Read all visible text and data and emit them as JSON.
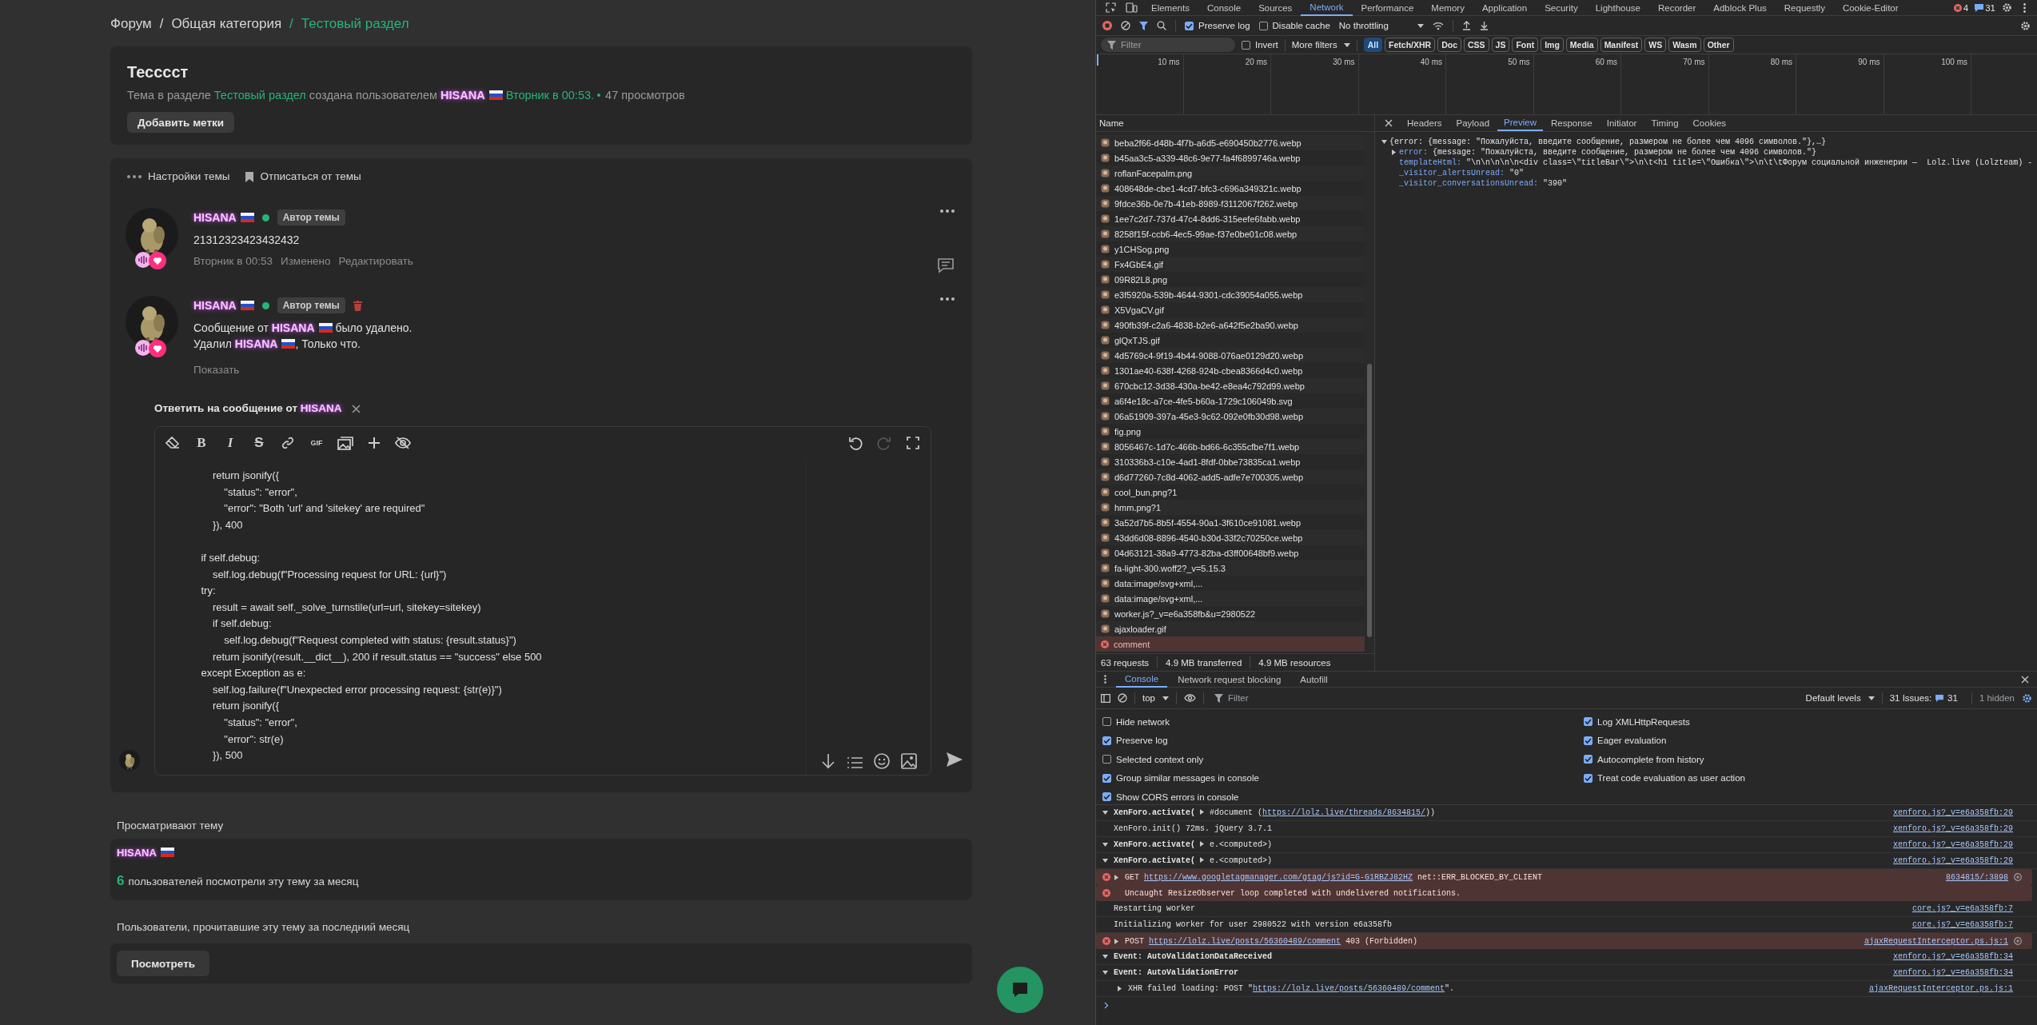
{
  "breadcrumb": {
    "separator": "/",
    "items": [
      {
        "label": "Форум",
        "current": false
      },
      {
        "label": "Общая категория",
        "current": false
      },
      {
        "label": "Тестовый раздел",
        "current": true
      }
    ]
  },
  "thread": {
    "title": "Тесссст",
    "meta": [
      {
        "kind": "text",
        "text": "Тема в разделе"
      },
      {
        "kind": "link",
        "text": "Тестовый раздел"
      },
      {
        "kind": "text",
        "text": "создана пользователем"
      },
      {
        "kind": "user",
        "text": "HISANA"
      },
      {
        "kind": "link",
        "text": "Вторник в 00:53."
      },
      {
        "kind": "stat",
        "text": "47 просмотров"
      }
    ],
    "tag_button": "Добавить метки"
  },
  "thread_actions": [
    "Настройки темы",
    "Отписаться от темы"
  ],
  "posts": [
    {
      "author": "HISANA",
      "online": true,
      "badge": "Автор темы",
      "deleted": false,
      "body": [
        [
          {
            "kind": "text",
            "text": "21312323423432432"
          }
        ]
      ],
      "footer": [
        "Вторник в 00:53",
        "Изменено",
        "Редактировать"
      ]
    },
    {
      "author": "HISANA",
      "online": true,
      "badge": "Автор темы",
      "deleted": true,
      "body": [
        [
          {
            "kind": "text",
            "text": "Сообщение от"
          },
          {
            "kind": "user",
            "text": "HISANA"
          },
          {
            "kind": "text",
            "text": "было удалено."
          }
        ],
        [
          {
            "kind": "text",
            "text": "Удалил"
          },
          {
            "kind": "user",
            "text": "HISANA"
          },
          {
            "kind": "text",
            "text": ", Только что.",
            "attach": true
          }
        ]
      ],
      "footer": [
        "Показать"
      ]
    }
  ],
  "reply": {
    "label": "Ответить на сообщение от",
    "user": "HISANA"
  },
  "editor": {
    "glyphs": {
      "bold": "B",
      "italic": "I",
      "strike": "S",
      "gif": "GIF"
    },
    "redo_disabled": true,
    "lines": [
      {
        "text": "        return jsonify({"
      },
      {
        "text": "            \"status\": \"error\","
      },
      {
        "text": "            \"error\": \"Both 'url' and 'sitekey' are required\""
      },
      {
        "text": "        }), 400"
      },
      {
        "text": "    if self.debug:",
        "space_before": true
      },
      {
        "text": "        self.log.debug(f\"Processing request for URL: {url}\")"
      },
      {
        "text": "    try:"
      },
      {
        "text": "        result = await self._solve_turnstile(url=url, sitekey=sitekey)"
      },
      {
        "text": "        if self.debug:"
      },
      {
        "text": "            self.log.debug(f\"Request completed with status: {result.status}\")"
      },
      {
        "text": "        return jsonify(result.__dict__), 200 if result.status == \"success\" else 500"
      },
      {
        "text": "    except Exception as e:"
      },
      {
        "text": "        self.log.failure(f\"Unexpected error processing request: {str(e)}\")"
      },
      {
        "text": "        return jsonify({"
      },
      {
        "text": "            \"status\": \"error\","
      },
      {
        "text": "            \"error\": str(e)"
      },
      {
        "text": "        }), 500"
      }
    ]
  },
  "viewers": {
    "label": "Просматривают тему",
    "users": [
      "HISANA"
    ],
    "count": "6",
    "count_text": "пользователей посмотрели эту тему за месяц"
  },
  "readers": {
    "label": "Пользователи, прочитавшие эту тему за последний месяц",
    "button": "Посмотреть"
  },
  "devtools": {
    "tabs": [
      {
        "label": "Elements",
        "selected": false
      },
      {
        "label": "Console",
        "selected": false
      },
      {
        "label": "Sources",
        "selected": false
      },
      {
        "label": "Network",
        "selected": true
      },
      {
        "label": "Performance",
        "selected": false
      },
      {
        "label": "Memory",
        "selected": false
      },
      {
        "label": "Application",
        "selected": false
      },
      {
        "label": "Security",
        "selected": false
      },
      {
        "label": "Lighthouse",
        "selected": false
      },
      {
        "label": "Recorder",
        "selected": false
      },
      {
        "label": "Adblock Plus",
        "selected": false
      },
      {
        "label": "Requestly",
        "selected": false
      },
      {
        "label": "Cookie-Editor",
        "selected": false
      }
    ],
    "error_count": "4",
    "issue_count": "31",
    "checkboxes": [
      {
        "label": "Preserve log",
        "checked": true
      },
      {
        "label": "Disable cache",
        "checked": false
      }
    ],
    "throttling": "No throttling",
    "filter": {
      "placeholder": "Filter",
      "invert": {
        "label": "Invert",
        "checked": false
      },
      "more": "More filters",
      "types": [
        {
          "label": "All",
          "selected": true
        },
        {
          "label": "Fetch/XHR",
          "selected": false
        },
        {
          "label": "Doc",
          "selected": false
        },
        {
          "label": "CSS",
          "selected": false
        },
        {
          "label": "JS",
          "selected": false
        },
        {
          "label": "Font",
          "selected": false
        },
        {
          "label": "Img",
          "selected": false
        },
        {
          "label": "Media",
          "selected": false
        },
        {
          "label": "Manifest",
          "selected": false
        },
        {
          "label": "WS",
          "selected": false
        },
        {
          "label": "Wasm",
          "selected": false
        },
        {
          "label": "Other",
          "selected": false
        }
      ]
    },
    "timeline_ticks": [
      "10 ms",
      "20 ms",
      "30 ms",
      "40 ms",
      "50 ms",
      "60 ms",
      "70 ms",
      "80 ms",
      "90 ms",
      "100 ms"
    ],
    "requests": {
      "header": "Name",
      "rows": [
        {
          "name": "beba2f66-d48b-4f7b-a6d5-e690450b2776.webp",
          "failed": false
        },
        {
          "name": "b45aa3c5-a339-48c6-9e77-fa4f6899746a.webp",
          "failed": false
        },
        {
          "name": "roflanFacepalm.png",
          "failed": false
        },
        {
          "name": "408648de-cbe1-4cd7-bfc3-c696a349321c.webp",
          "failed": false
        },
        {
          "name": "9fdce36b-0e7b-41eb-8989-f3112067f262.webp",
          "failed": false
        },
        {
          "name": "1ee7c2d7-737d-47c4-8dd6-315eefe6fabb.webp",
          "failed": false
        },
        {
          "name": "8258f15f-ccb6-4ec5-99ae-f37e0be01c08.webp",
          "failed": false
        },
        {
          "name": "y1CHSog.png",
          "failed": false
        },
        {
          "name": "Fx4GbE4.gif",
          "failed": false
        },
        {
          "name": "09R82L8.png",
          "failed": false
        },
        {
          "name": "e3f5920a-539b-4644-9301-cdc39054a055.webp",
          "failed": false
        },
        {
          "name": "X5VgaCV.gif",
          "failed": false
        },
        {
          "name": "490fb39f-c2a6-4838-b2e6-a642f5e2ba90.webp",
          "failed": false
        },
        {
          "name": "glQxTJS.gif",
          "failed": false
        },
        {
          "name": "4d5769c4-9f19-4b44-9088-076ae0129d20.webp",
          "failed": false
        },
        {
          "name": "1301ae40-638f-4268-924b-cbea8366d4c0.webp",
          "failed": false
        },
        {
          "name": "670cbc12-3d38-430a-be42-e8ea4c792d99.webp",
          "failed": false
        },
        {
          "name": "a6f4e18c-a7ce-4fe5-b60a-1729c106049b.svg",
          "failed": false
        },
        {
          "name": "06a51909-397a-45e3-9c62-092e0fb30d98.webp",
          "failed": false
        },
        {
          "name": "fig.png",
          "failed": false
        },
        {
          "name": "8056467c-1d7c-466b-bd66-6c355cfbe7f1.webp",
          "failed": false
        },
        {
          "name": "310336b3-c10e-4ad1-8fdf-0bbe73835ca1.webp",
          "failed": false
        },
        {
          "name": "d6d77260-7c8d-4062-add5-adfe7e700305.webp",
          "failed": false
        },
        {
          "name": "cool_bun.png?1",
          "failed": false
        },
        {
          "name": "hmm.png?1",
          "failed": false
        },
        {
          "name": "3a52d7b5-8b5f-4554-90a1-3f610ce91081.webp",
          "failed": false
        },
        {
          "name": "43dd6d08-8896-4540-b30d-33f2c70250ce.webp",
          "failed": false
        },
        {
          "name": "04d63121-38a9-4773-82ba-d3ff00648bf9.webp",
          "failed": false
        },
        {
          "name": "fa-light-300.woff2?_v=5.15.3",
          "failed": false
        },
        {
          "name": "data:image/svg+xml,...",
          "failed": false
        },
        {
          "name": "data:image/svg+xml,...",
          "failed": false
        },
        {
          "name": "worker.js?_v=e6a358fb&u=2980522",
          "failed": false
        },
        {
          "name": "ajaxloader.gif",
          "failed": false
        },
        {
          "name": "comment",
          "failed": true
        }
      ],
      "summary": [
        "63 requests",
        "4.9 MB transferred",
        "4.9 MB resources"
      ]
    },
    "detail": {
      "tabs": [
        {
          "label": "Headers",
          "selected": false
        },
        {
          "label": "Payload",
          "selected": false
        },
        {
          "label": "Preview",
          "selected": true
        },
        {
          "label": "Response",
          "selected": false
        },
        {
          "label": "Initiator",
          "selected": false
        },
        {
          "label": "Timing",
          "selected": false
        },
        {
          "label": "Cookies",
          "selected": false
        }
      ],
      "preview": [
        {
          "expanded": true,
          "value": "{error: {message: \"Пожалуйста, введите сообщение, размером не более чем 4096 символов.\"},…}"
        },
        {
          "expanded": false,
          "key": "error:",
          "value": "{message: \"Пожалуйста, введите сообщение, размером не более чем 4096 символов.\"}"
        },
        {
          "key": "templateHtml:",
          "value": "\"\\n\\n\\n\\n\\n<div class=\\\"titleBar\\\">\\n\\t<h1 title=\\\"Ошибка\\\">\\n\\t\\tФорум социальной инженерии —  Lolz.live (Lolzteam) -"
        },
        {
          "key": "_visitor_alertsUnread:",
          "value": "\"0\""
        },
        {
          "key": "_visitor_conversationsUnread:",
          "value": "\"390\""
        }
      ]
    },
    "console": {
      "tabs": [
        {
          "label": "Console",
          "selected": true
        },
        {
          "label": "Network request blocking",
          "selected": false
        },
        {
          "label": "Autofill",
          "selected": false
        }
      ],
      "context": "top",
      "filter_placeholder": "Filter",
      "levels": "Default levels",
      "issues_label": "31 Issues:",
      "issues_count": "31",
      "hidden": "1 hidden",
      "settings_left": [
        {
          "label": "Hide network",
          "checked": false
        },
        {
          "label": "Preserve log",
          "checked": true
        },
        {
          "label": "Selected context only",
          "checked": false
        },
        {
          "label": "Group similar messages in console",
          "checked": true
        },
        {
          "label": "Show CORS errors in console",
          "checked": true
        }
      ],
      "settings_right": [
        {
          "label": "Log XMLHttpRequests",
          "checked": true
        },
        {
          "label": "Eager evaluation",
          "checked": true
        },
        {
          "label": "Autocomplete from history",
          "checked": true
        },
        {
          "label": "Treat code evaluation as user action",
          "checked": true
        }
      ],
      "messages": [
        {
          "error": false,
          "expanded": true,
          "parts": [
            {
              "kind": "strong",
              "text": "XenForo.activate( "
            },
            {
              "kind": "arrow"
            },
            {
              "kind": "text",
              "text": " #document ("
            },
            {
              "kind": "link",
              "text": "https://lolz.live/threads/8634815/"
            },
            {
              "kind": "text",
              "text": "))"
            }
          ],
          "source": "xenforo.js?_v=e6a358fb:29"
        },
        {
          "error": false,
          "parts": [
            {
              "kind": "text",
              "text": "XenForo.init() 72ms. jQuery 3.7.1"
            }
          ],
          "source": "xenforo.js?_v=e6a358fb:29"
        },
        {
          "error": false,
          "expanded": true,
          "parts": [
            {
              "kind": "strong",
              "text": "XenForo.activate( "
            },
            {
              "kind": "arrow"
            },
            {
              "kind": "text",
              "text": " e.<computed>)"
            }
          ],
          "source": "xenforo.js?_v=e6a358fb:29"
        },
        {
          "error": false,
          "expanded": true,
          "parts": [
            {
              "kind": "strong",
              "text": "XenForo.activate( "
            },
            {
              "kind": "arrow"
            },
            {
              "kind": "text",
              "text": " e.<computed>)"
            }
          ],
          "source": "xenforo.js?_v=e6a358fb:29"
        },
        {
          "error": true,
          "expanded": false,
          "network": true,
          "parts": [
            {
              "kind": "text",
              "text": "GET "
            },
            {
              "kind": "link",
              "text": "https://www.googletagmanager.com/gtag/js?id=G-G1RBZJ82HZ"
            },
            {
              "kind": "text",
              "text": " net::ERR_BLOCKED_BY_CLIENT"
            }
          ],
          "source": "8634815/:3898"
        },
        {
          "error": true,
          "parts": [
            {
              "kind": "text",
              "text": "Uncaught ResizeObserver loop completed with undelivered notifications."
            }
          ]
        },
        {
          "error": false,
          "parts": [
            {
              "kind": "text",
              "text": "Restarting worker"
            }
          ],
          "source": "core.js?_v=e6a358fb:7"
        },
        {
          "error": false,
          "parts": [
            {
              "kind": "text",
              "text": "Initializing worker for user 2980522 with version e6a358fb"
            }
          ],
          "source": "core.js?_v=e6a358fb:7"
        },
        {
          "error": true,
          "expanded": false,
          "network": true,
          "parts": [
            {
              "kind": "text",
              "text": "POST "
            },
            {
              "kind": "link",
              "text": "https://lolz.live/posts/56360489/comment"
            },
            {
              "kind": "text",
              "text": " 403 (Forbidden)"
            }
          ],
          "source": "ajaxRequestInterceptor.ps.js:1"
        },
        {
          "error": false,
          "expanded": true,
          "parts": [
            {
              "kind": "strong",
              "text": "Event: AutoValidationDataReceived"
            }
          ],
          "source": "xenforo.js?_v=e6a358fb:34"
        },
        {
          "error": false,
          "expanded": true,
          "parts": [
            {
              "kind": "strong",
              "text": "Event: AutoValidationError"
            }
          ],
          "source": "xenforo.js?_v=e6a358fb:34",
          "children": [
            {
              "error": false,
              "expanded": false,
              "parts": [
                {
                  "kind": "text",
                  "text": "XHR failed loading: POST \""
                },
                {
                  "kind": "link",
                  "text": "https://lolz.live/posts/56360489/comment"
                },
                {
                  "kind": "text",
                  "text": "\"."
                }
              ],
              "source": "ajaxRequestInterceptor.ps.js:1"
            }
          ]
        }
      ]
    }
  }
}
